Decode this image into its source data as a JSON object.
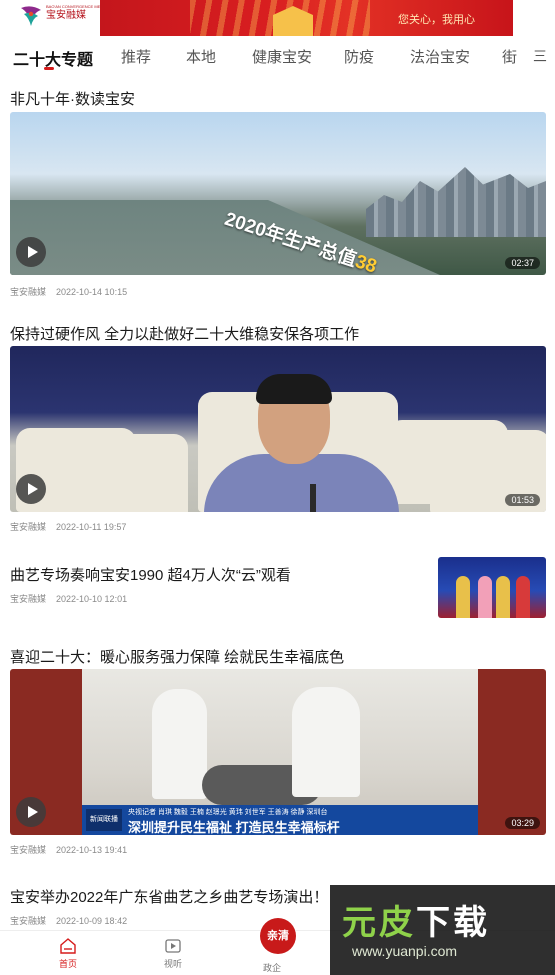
{
  "header": {
    "logo_text_top": "BAO'AN CONVERGENCE MEDIA",
    "logo_text": "宝安融媒",
    "ad_text": "您关心，我用心"
  },
  "tabs": [
    {
      "label": "二十大专题",
      "active": true
    },
    {
      "label": "推荐"
    },
    {
      "label": "本地"
    },
    {
      "label": "健康宝安"
    },
    {
      "label": "防疫"
    },
    {
      "label": "法治宝安"
    },
    {
      "label": "街"
    }
  ],
  "tab_more": "三",
  "feed": [
    {
      "title": "非凡十年·数读宝安",
      "source": "宝安融媒",
      "time": "2022-10-14 10:15",
      "duration": "02:37",
      "caption": "2020年生产总值",
      "caption_num": "38"
    },
    {
      "title": "保持过硬作风 全力以赴做好二十大维稳安保各项工作",
      "source": "宝安融媒",
      "time": "2022-10-11 19:57",
      "duration": "01:53"
    },
    {
      "title": "曲艺专场奏响宝安1990  超4万人次“云”观看",
      "source": "宝安融媒",
      "time": "2022-10-10 12:01"
    },
    {
      "title": "喜迎二十大：暖心服务强力保障 绘就民生幸福底色",
      "source": "宝安融媒",
      "time": "2022-10-13 19:41",
      "duration": "03:29",
      "ticker_top": "央视记者 肖琪 魏毅 王楠 赵璟光 黄玮 刘世军 王善涛 徐静 深圳台",
      "ticker_main": "深圳提升民生福祉 打造民生幸福标杆",
      "news_logo": "新闻联播"
    },
    {
      "title": "宝安举办2022年广东省曲艺之乡曲艺专场演出！",
      "source": "宝安融媒",
      "time": "2022-10-09 18:42"
    }
  ],
  "watermark": {
    "big_a": "元皮",
    "big_b": "下载",
    "url": "www.yuanpi.com"
  },
  "bottom_nav": {
    "home": "首页",
    "watch": "视听",
    "center_btn": "亲清",
    "center_label": "政企"
  },
  "colors": {
    "accent": "#d51b1b",
    "banner_red": "#c4161c"
  }
}
